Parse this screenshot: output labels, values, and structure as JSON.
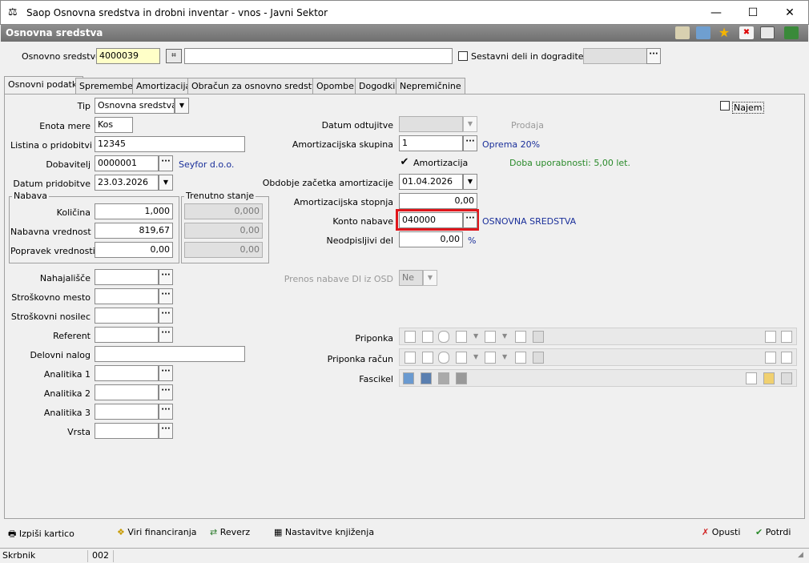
{
  "window": {
    "title": "Saop Osnovna sredstva in drobni inventar - vnos - Javni Sektor"
  },
  "header": {
    "title": "Osnovna sredstva"
  },
  "top": {
    "osnovno_label": "Osnovno sredstvo",
    "osnovno_value": "4000039",
    "desc_value": "",
    "sestavni_label": "Sestavni deli in dogradite",
    "sestavni_checked": false
  },
  "tabs": [
    "Osnovni podatki",
    "Spremembe",
    "Amortizacija",
    "Obračun za osnovno sredstvo",
    "Opombe",
    "Dogodki",
    "Nepremičnine"
  ],
  "left": {
    "tip_label": "Tip",
    "tip_value": "Osnovna sredstva",
    "enota_label": "Enota mere",
    "enota_value": "Kos",
    "listina_label": "Listina o pridobitvi",
    "listina_value": "12345",
    "dobavitelj_label": "Dobavitelj",
    "dobavitelj_value": "0000001",
    "dobavitelj_name": "Seyfor d.o.o.",
    "datum_label": "Datum pridobitve",
    "datum_value": "23.03.2026",
    "nabava_title": "Nabava",
    "stanje_title": "Trenutno stanje",
    "kolicina_label": "Količina",
    "kolicina_value": "1,000",
    "kolicina_stanje": "0,000",
    "nabavna_label": "Nabavna vrednost",
    "nabavna_value": "819,67",
    "nabavna_stanje": "0,00",
    "popravek_label": "Popravek vrednosti",
    "popravek_value": "0,00",
    "popravek_stanje": "0,00",
    "nahajalisce_label": "Nahajališče",
    "stroskovno_mesto_label": "Stroškovno mesto",
    "stroskovni_nosilec_label": "Stroškovni nosilec",
    "referent_label": "Referent",
    "delovni_nalog_label": "Delovni nalog",
    "analitika1_label": "Analitika 1",
    "analitika2_label": "Analitika 2",
    "analitika3_label": "Analitika 3",
    "vrsta_label": "Vrsta"
  },
  "right": {
    "najem_label": "Najem",
    "najem_checked": false,
    "odtujitve_label": "Datum odtujitve",
    "prodaja_label": "Prodaja",
    "skupina_label": "Amortizacijska skupina",
    "skupina_value": "1",
    "skupina_name": "Oprema 20%",
    "amortizacija_label": "Amortizacija",
    "amortizacija_checked": true,
    "doba": "Doba uporabnosti: 5,00 let.",
    "obdobje_label": "Obdobje začetka amortizacije",
    "obdobje_value": "01.04.2026",
    "stopnja_label": "Amortizacijska stopnja",
    "stopnja_value": "0,00",
    "konto_label": "Konto nabave",
    "konto_value": "040000",
    "konto_name": "OSNOVNA SREDSTVA",
    "neodpisljivi_label": "Neodpisljivi del",
    "neodpisljivi_value": "0,00",
    "pct": "%",
    "prenos_label": "Prenos nabave DI iz OSD",
    "prenos_value": "Ne",
    "priponka_label": "Priponka",
    "priponka_racun_label": "Priponka račun",
    "fascikel_label": "Fascikel"
  },
  "bottom": {
    "izpisi": "Izpiši kartico",
    "viri": "Viri financiranja",
    "reverz": "Reverz",
    "nastavitve": "Nastavitve knjiženja",
    "opusti": "Opusti",
    "potrdi": "Potrdi"
  },
  "status": {
    "user": "Skrbnik",
    "code": "002"
  },
  "colors": {
    "highlight": "#e0151b",
    "header": "#7f7f7f",
    "link": "#1a2f9a",
    "ok": "#2a8a2a"
  }
}
